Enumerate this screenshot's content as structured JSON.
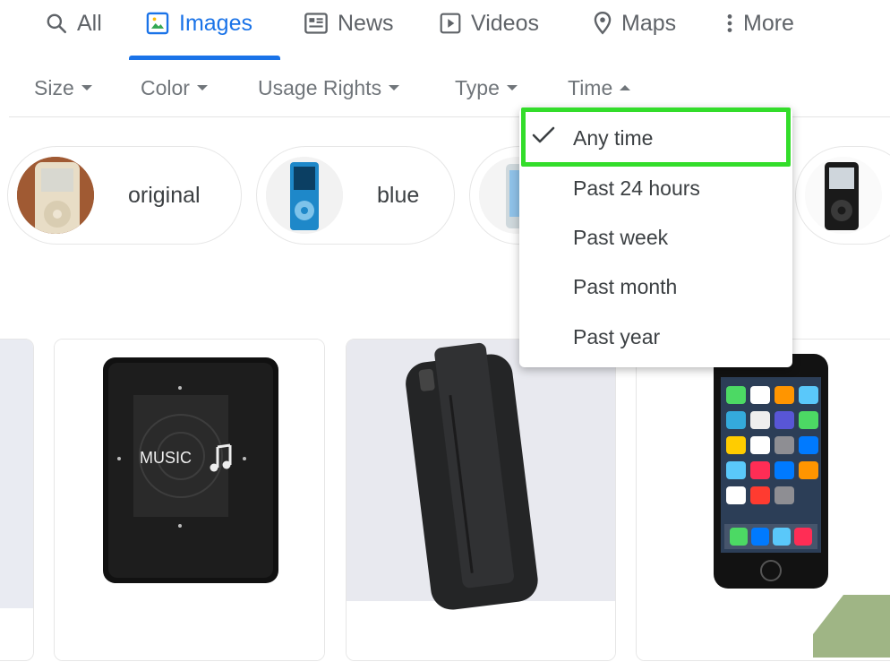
{
  "tabs": [
    {
      "label": "All",
      "icon": "search-icon"
    },
    {
      "label": "Images",
      "icon": "image-icon"
    },
    {
      "label": "News",
      "icon": "newspaper-icon"
    },
    {
      "label": "Videos",
      "icon": "play-icon"
    },
    {
      "label": "Maps",
      "icon": "map-pin-icon"
    },
    {
      "label": "More",
      "icon": "more-vertical-icon"
    }
  ],
  "active_tab": "Images",
  "filters": [
    "Size",
    "Color",
    "Usage Rights",
    "Type",
    "Time"
  ],
  "open_filter": "Time",
  "time_menu": {
    "options": [
      "Any time",
      "Past 24 hours",
      "Past week",
      "Past month",
      "Past year"
    ],
    "selected": "Any time"
  },
  "chips": [
    {
      "label": "original"
    },
    {
      "label": "blue"
    }
  ],
  "result_screen_text": "MUSIC",
  "colors": {
    "accent": "#1a73e8",
    "highlight": "#33dd2a"
  }
}
